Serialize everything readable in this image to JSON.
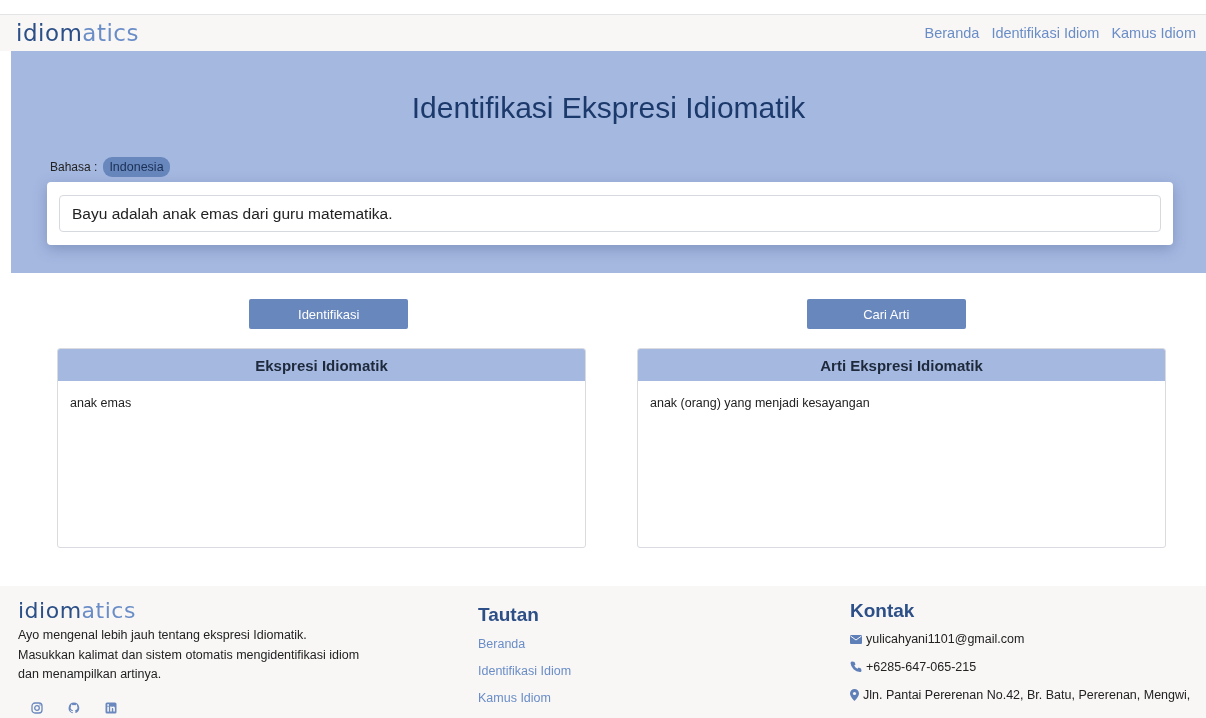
{
  "navbar": {
    "logo": {
      "dark": "idiom",
      "light": "atics"
    },
    "links": [
      "Beranda",
      "Identifikasi Idiom",
      "Kamus Idiom"
    ]
  },
  "hero": {
    "title": "Identifikasi Ekspresi Idiomatik",
    "language_label": "Bahasa :",
    "language": "Indonesia",
    "input_value": "Bayu adalah anak emas dari guru matematika."
  },
  "buttons": [
    "Identifikasi",
    "Cari Arti"
  ],
  "panels": [
    {
      "title": "Ekspresi Idiomatik",
      "content": "anak emas"
    },
    {
      "title": "Arti Ekspresi Idiomatik",
      "content": "anak (orang) yang menjadi kesayangan"
    }
  ],
  "footer": {
    "logo": {
      "dark": "idiom",
      "light": "atics"
    },
    "about": [
      "Ayo mengenal lebih jauh tentang ekspresi Idiomatik.",
      "Masukkan kalimat dan sistem otomatis mengidentifikasi idiom",
      "dan menampilkan artinya."
    ],
    "social": [
      {
        "kind": "instagram"
      },
      {
        "kind": "github"
      },
      {
        "kind": "linkedin"
      }
    ],
    "links_title": "Tautan",
    "links": [
      "Beranda",
      "Identifikasi Idiom",
      "Kamus Idiom"
    ],
    "contact_title": "Kontak",
    "contacts": [
      {
        "kind": "email",
        "text": "yulicahyani1101@gmail.com"
      },
      {
        "kind": "phone",
        "text": "+6285-647-065-215"
      },
      {
        "kind": "location",
        "text": "Jln. Pantai Pererenan No.42, Br. Batu, Pererenan, Mengwi,"
      }
    ]
  }
}
